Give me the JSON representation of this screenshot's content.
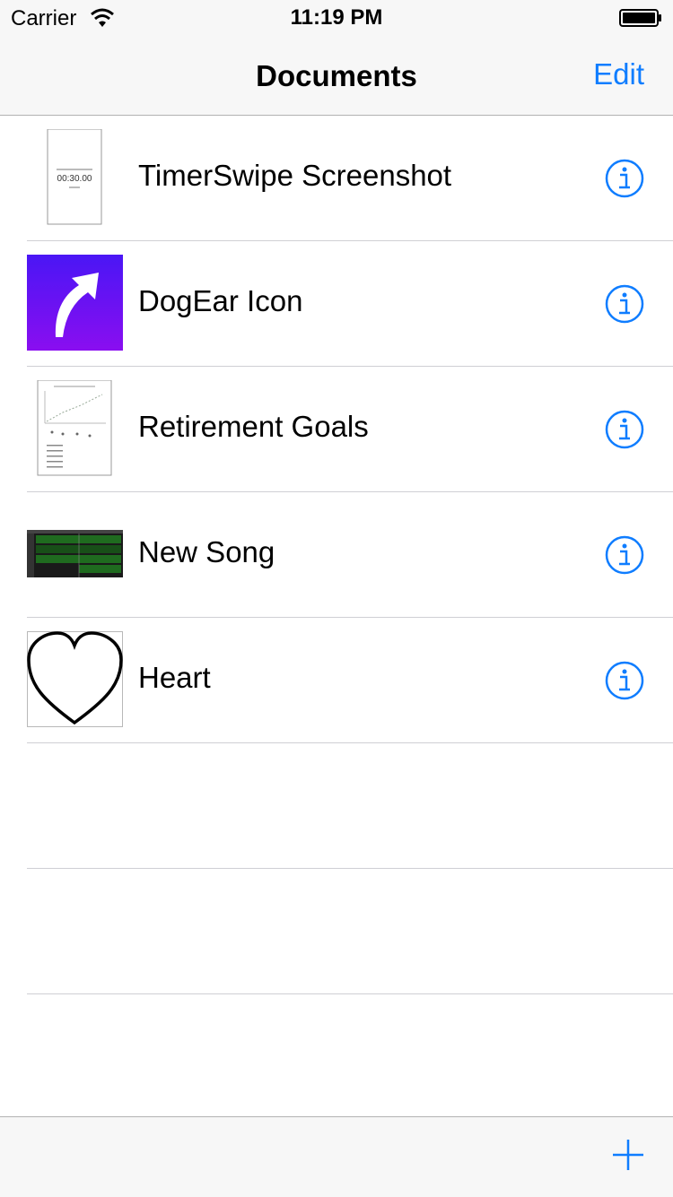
{
  "status_bar": {
    "carrier": "Carrier",
    "time": "11:19 PM"
  },
  "nav": {
    "title": "Documents",
    "edit_label": "Edit"
  },
  "thumb_text": {
    "timer": "00:30.00"
  },
  "documents": [
    {
      "name": "TimerSwipe Screenshot",
      "thumb_icon": "phone-screenshot-thumbnail"
    },
    {
      "name": "DogEar Icon",
      "thumb_icon": "purple-arrow-icon-thumbnail"
    },
    {
      "name": "Retirement Goals",
      "thumb_icon": "document-chart-thumbnail"
    },
    {
      "name": "New Song",
      "thumb_icon": "music-tracks-thumbnail"
    },
    {
      "name": "Heart",
      "thumb_icon": "heart-outline-thumbnail"
    }
  ],
  "colors": {
    "accent": "#0f7dff",
    "bar_bg": "#f7f7f7",
    "separator": "#cfcfd4"
  },
  "icons": {
    "info": "info-circle-icon",
    "add": "plus-icon"
  }
}
